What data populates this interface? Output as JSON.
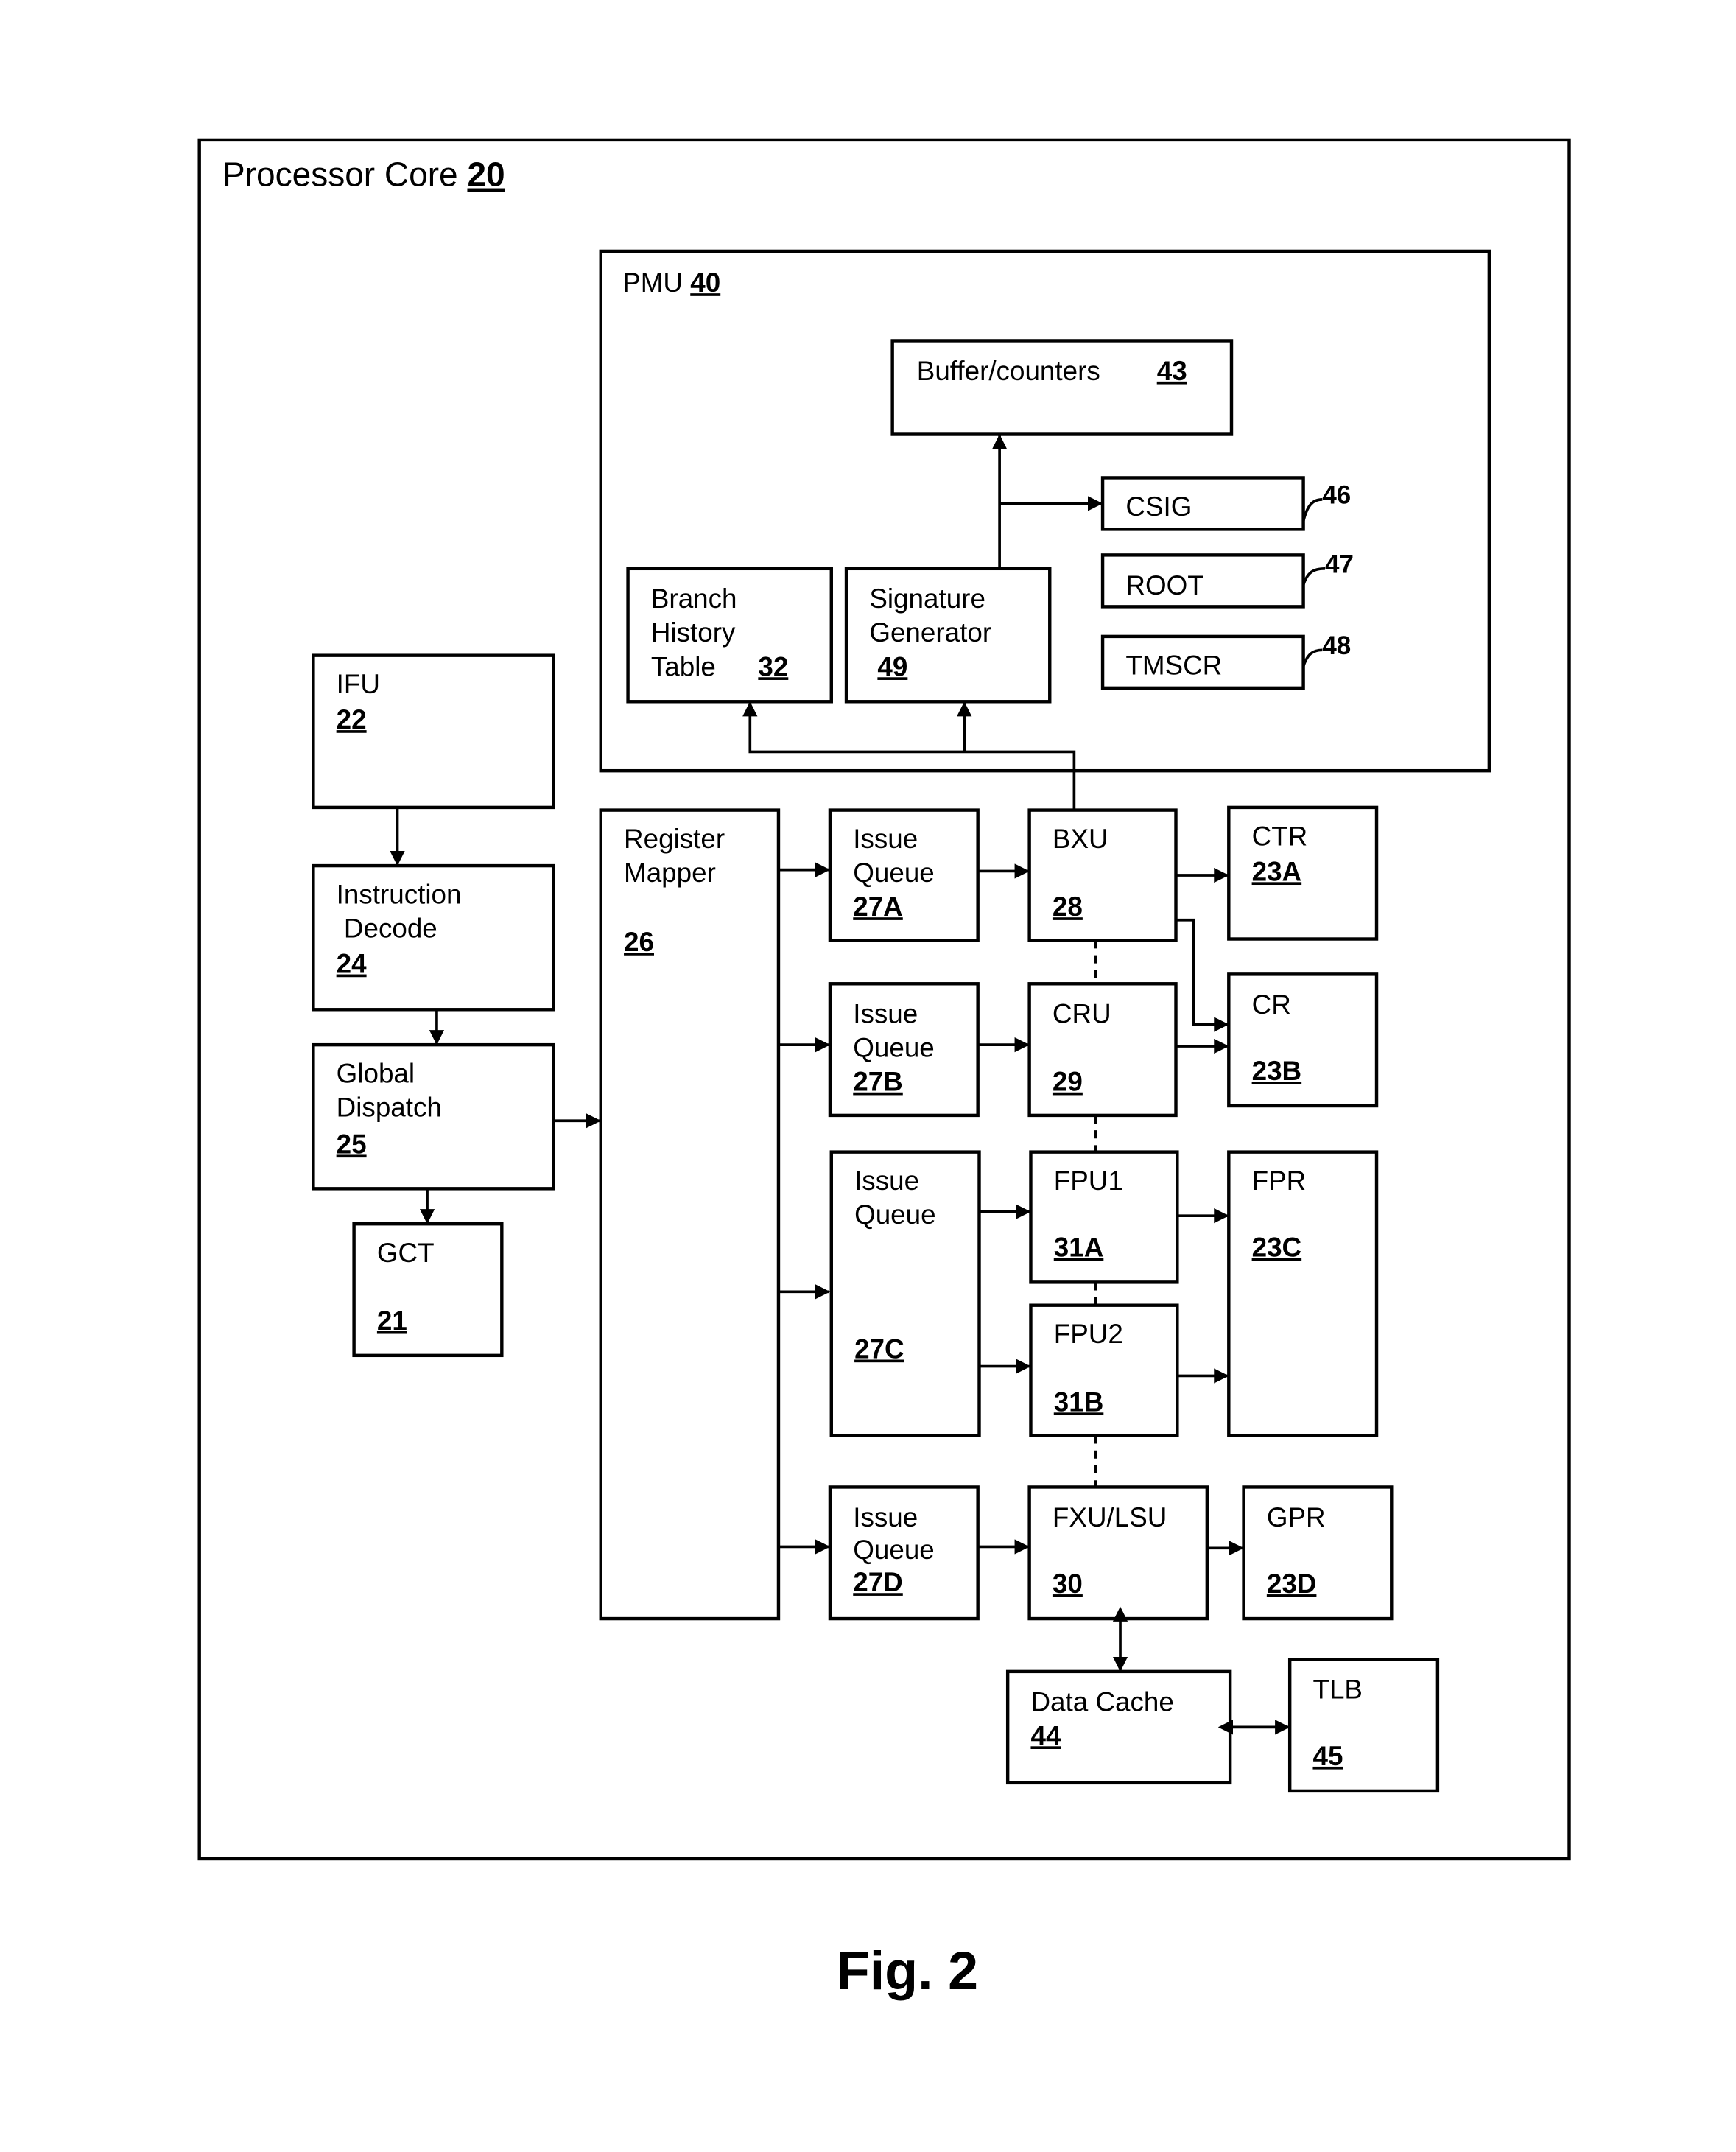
{
  "figure": {
    "caption": "Fig. 2",
    "container": {
      "label": "Processor Core",
      "ref": "20"
    },
    "pmu": {
      "label": "PMU",
      "ref": "40"
    },
    "blocks": {
      "buffer_counters": {
        "lines": [
          "Buffer/counters"
        ],
        "ref": "43"
      },
      "csig": {
        "lines": [
          "CSIG"
        ],
        "ref": "46"
      },
      "root": {
        "lines": [
          "ROOT"
        ],
        "ref": "47"
      },
      "tmscr": {
        "lines": [
          "TMSCR"
        ],
        "ref": "48"
      },
      "bht": {
        "lines": [
          "Branch",
          "History",
          "Table"
        ],
        "ref": "32"
      },
      "siggen": {
        "lines": [
          "Signature",
          "Generator"
        ],
        "ref": "49"
      },
      "ifu": {
        "lines": [
          "IFU"
        ],
        "ref": "22"
      },
      "idecode": {
        "lines": [
          "Instruction",
          " Decode"
        ],
        "ref": "24"
      },
      "gdispatch": {
        "lines": [
          "Global",
          "Dispatch"
        ],
        "ref": "25"
      },
      "gct": {
        "lines": [
          "GCT"
        ],
        "ref": "21"
      },
      "regmap": {
        "lines": [
          "Register",
          "Mapper"
        ],
        "ref": "26"
      },
      "iq_a": {
        "lines": [
          "Issue",
          "Queue"
        ],
        "ref": "27A"
      },
      "iq_b": {
        "lines": [
          "Issue",
          "Queue"
        ],
        "ref": "27B"
      },
      "iq_c": {
        "lines": [
          "Issue",
          "Queue"
        ],
        "ref": "27C"
      },
      "iq_d": {
        "lines": [
          "Issue",
          "Queue"
        ],
        "ref": "27D"
      },
      "bxu": {
        "lines": [
          "BXU"
        ],
        "ref": "28"
      },
      "cru": {
        "lines": [
          "CRU"
        ],
        "ref": "29"
      },
      "fpu1": {
        "lines": [
          "FPU1"
        ],
        "ref": "31A"
      },
      "fpu2": {
        "lines": [
          "FPU2"
        ],
        "ref": "31B"
      },
      "fxu_lsu": {
        "lines": [
          "FXU/LSU"
        ],
        "ref": "30"
      },
      "ctr": {
        "lines": [
          "CTR"
        ],
        "ref": "23A"
      },
      "cr": {
        "lines": [
          "CR"
        ],
        "ref": "23B"
      },
      "fpr": {
        "lines": [
          "FPR"
        ],
        "ref": "23C"
      },
      "gpr": {
        "lines": [
          "GPR"
        ],
        "ref": "23D"
      },
      "dcache": {
        "lines": [
          "Data Cache"
        ],
        "ref": "44"
      },
      "tlb": {
        "lines": [
          "TLB"
        ],
        "ref": "45"
      }
    }
  }
}
